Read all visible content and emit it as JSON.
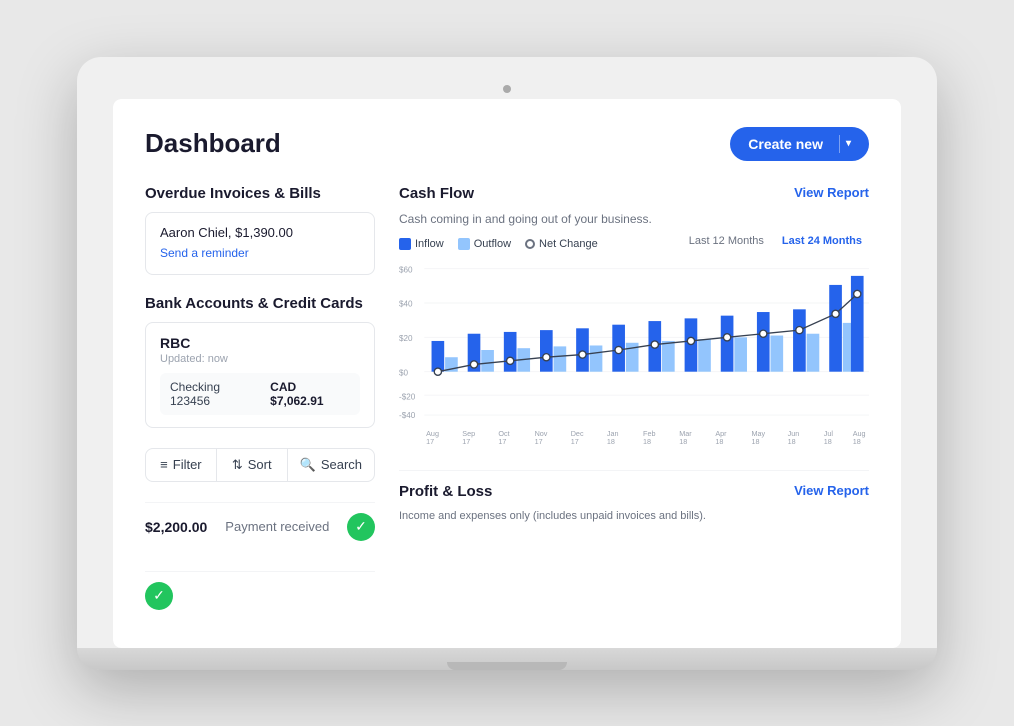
{
  "header": {
    "title": "Dashboard",
    "create_button": "Create new"
  },
  "overdue": {
    "section_title": "Overdue Invoices & Bills",
    "customer": "Aaron Chiel, $1,390.00",
    "reminder_text": "Send a reminder"
  },
  "bank": {
    "section_title": "Bank Accounts & Credit Cards",
    "bank_name": "RBC",
    "updated_text": "Updated: now",
    "account_label": "Checking 123456",
    "account_currency": "CAD $7,062.91"
  },
  "toolbar": {
    "filter_label": "Filter",
    "sort_label": "Sort",
    "search_label": "Search"
  },
  "transaction": {
    "amount": "$2,200.00",
    "description": "Payment received"
  },
  "cashflow": {
    "section_title": "Cash Flow",
    "subtitle": "Cash coming in and going out of your business.",
    "view_report": "View Report",
    "legend": {
      "inflow": "Inflow",
      "outflow": "Outflow",
      "net_change": "Net Change"
    },
    "period_12": "Last 12 Months",
    "period_24": "Last 24 Months",
    "y_labels": [
      "$60",
      "$40",
      "$20",
      "$0",
      "-$20",
      "-$40"
    ],
    "x_labels": [
      "Aug 17",
      "Sep 17",
      "Oct 17",
      "Nov 17",
      "Dec 17",
      "Jan 18",
      "Feb 18",
      "Mar 18",
      "Apr 18",
      "May 18",
      "Jun 18",
      "Jul 18",
      "Aug 18"
    ]
  },
  "profit_loss": {
    "section_title": "Profit & Loss",
    "subtitle": "Income and expenses only (includes unpaid invoices and bills).",
    "view_report": "View Report"
  }
}
